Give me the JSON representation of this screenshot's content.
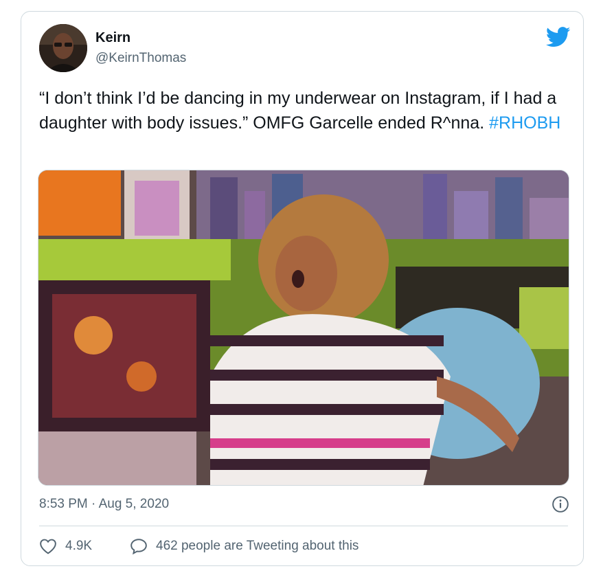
{
  "tweet": {
    "author_name": "Keirn",
    "author_handle": "@KeirnThomas",
    "text": "“I don’t think I’d be dancing in my underwear on Instagram, if I had a daughter with body issues.” OMFG Garcelle ended R^nna. ",
    "hashtag": "#RHOBH",
    "timestamp": "8:53 PM · Aug 5, 2020",
    "likes": "4.9K",
    "conversation": "462 people are Tweeting about this"
  },
  "icons": {
    "brand": "twitter-bird-icon",
    "info": "info-icon",
    "like": "heart-icon",
    "reply": "speech-bubble-icon"
  },
  "colors": {
    "brand_blue": "#1d9bf0",
    "secondary_text": "#536471",
    "border": "#cfd9de"
  }
}
